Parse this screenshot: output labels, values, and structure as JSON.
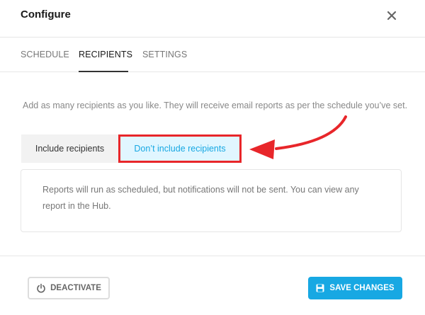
{
  "header": {
    "title": "Configure"
  },
  "tabs": [
    {
      "label": "SCHEDULE",
      "active": false
    },
    {
      "label": "RECIPIENTS",
      "active": true
    },
    {
      "label": "SETTINGS",
      "active": false
    }
  ],
  "recipients": {
    "description": "Add as many recipients as you like. They will receive email reports as per the schedule you’ve set.",
    "options": [
      {
        "label": "Include recipients",
        "selected": false
      },
      {
        "label": "Don’t include recipients",
        "selected": true
      }
    ],
    "notice": "Reports will run as scheduled, but notifications will not be sent. You can view any report in the Hub."
  },
  "footer": {
    "deactivate_label": "DEACTIVATE",
    "save_label": "SAVE CHANGES"
  },
  "colors": {
    "accent": "#17a8e3",
    "highlight": "#e8262a",
    "selected_bg": "#e1f6ff"
  },
  "icons": {
    "close": "close-icon",
    "deactivate": "power-icon",
    "save": "save-icon"
  }
}
